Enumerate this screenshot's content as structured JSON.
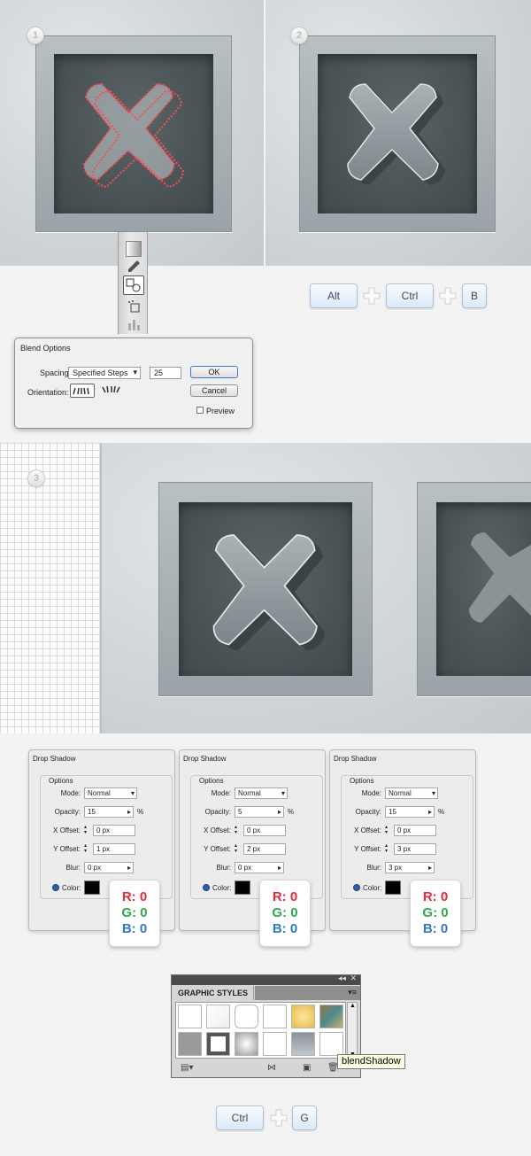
{
  "steps": {
    "one": "1",
    "two": "2",
    "three": "3"
  },
  "shortcut_blend": {
    "key1": "Alt",
    "key2": "Ctrl",
    "key3": "B"
  },
  "blend_options": {
    "title": "Blend Options",
    "spacing_label": "Spacing:",
    "spacing_value": "Specified Steps",
    "steps_value": "25",
    "orientation_label": "Orientation:",
    "ok": "OK",
    "cancel": "Cancel",
    "preview": "Preview"
  },
  "drop_shadows": [
    {
      "title": "Drop Shadow",
      "options": "Options",
      "mode_label": "Mode:",
      "mode": "Normal",
      "opacity_label": "Opacity:",
      "opacity": "15",
      "pct": "%",
      "x_label": "X Offset:",
      "x": "0 px",
      "y_label": "Y Offset:",
      "y": "1 px",
      "blur_label": "Blur:",
      "blur": "0 px",
      "color_label": "Color:",
      "r": "R: 0",
      "g": "G: 0",
      "b": "B: 0"
    },
    {
      "title": "Drop Shadow",
      "options": "Options",
      "mode_label": "Mode:",
      "mode": "Normal",
      "opacity_label": "Opacity:",
      "opacity": "5",
      "pct": "%",
      "x_label": "X Offset:",
      "x": "0 px",
      "y_label": "Y Offset:",
      "y": "2 px",
      "blur_label": "Blur:",
      "blur": "0 px",
      "color_label": "Color:",
      "r": "R: 0",
      "g": "G: 0",
      "b": "B: 0"
    },
    {
      "title": "Drop Shadow",
      "options": "Options",
      "mode_label": "Mode:",
      "mode": "Normal",
      "opacity_label": "Opacity:",
      "opacity": "15",
      "pct": "%",
      "x_label": "X Offset:",
      "x": "0 px",
      "y_label": "Y Offset:",
      "y": "3 px",
      "blur_label": "Blur:",
      "blur": "3 px",
      "color_label": "Color:",
      "r": "R: 0",
      "g": "G: 0",
      "b": "B: 0"
    }
  ],
  "graphic_styles": {
    "title": "GRAPHIC STYLES",
    "tooltip": "blendShadow"
  },
  "shortcut_group": {
    "key1": "Ctrl",
    "key2": "G"
  },
  "colors": {
    "red": "#e8283a",
    "green": "#2fa84f",
    "blue": "#2f78c4",
    "key_text": "#34495e"
  }
}
